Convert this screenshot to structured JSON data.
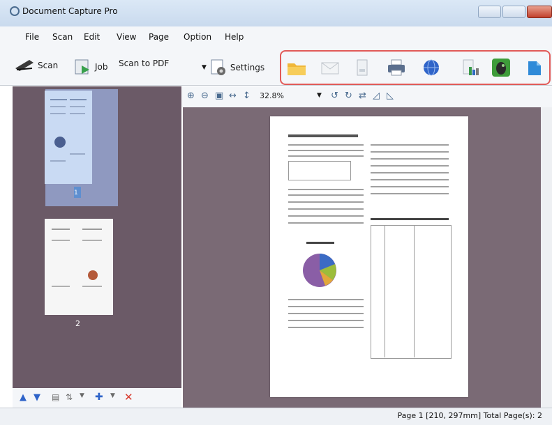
{
  "window": {
    "title": "Document Capture Pro"
  },
  "menu": [
    "File",
    "Scan",
    "Edit",
    "View",
    "Page",
    "Option",
    "Help"
  ],
  "toolbar": {
    "scan_label": "Scan",
    "job_label": "Job",
    "scan_to_pdf_label": "Scan to PDF",
    "settings_label": "Settings",
    "destinations": [
      "folder-icon",
      "email-icon",
      "document-icon",
      "printer-icon",
      "web-icon",
      "sharepoint-icon",
      "evernote-icon",
      "cloud-icon"
    ]
  },
  "viewer": {
    "zoom": "32.8%"
  },
  "thumbnails": [
    {
      "label": "1"
    },
    {
      "label": "2"
    }
  ],
  "status": {
    "text": "Page 1 [210, 297mm]  Total Page(s): 2"
  },
  "colors": {
    "panel_bg": "#6b5a67",
    "highlight_red": "#e15a58",
    "title_bar": "#dbe8f6"
  }
}
